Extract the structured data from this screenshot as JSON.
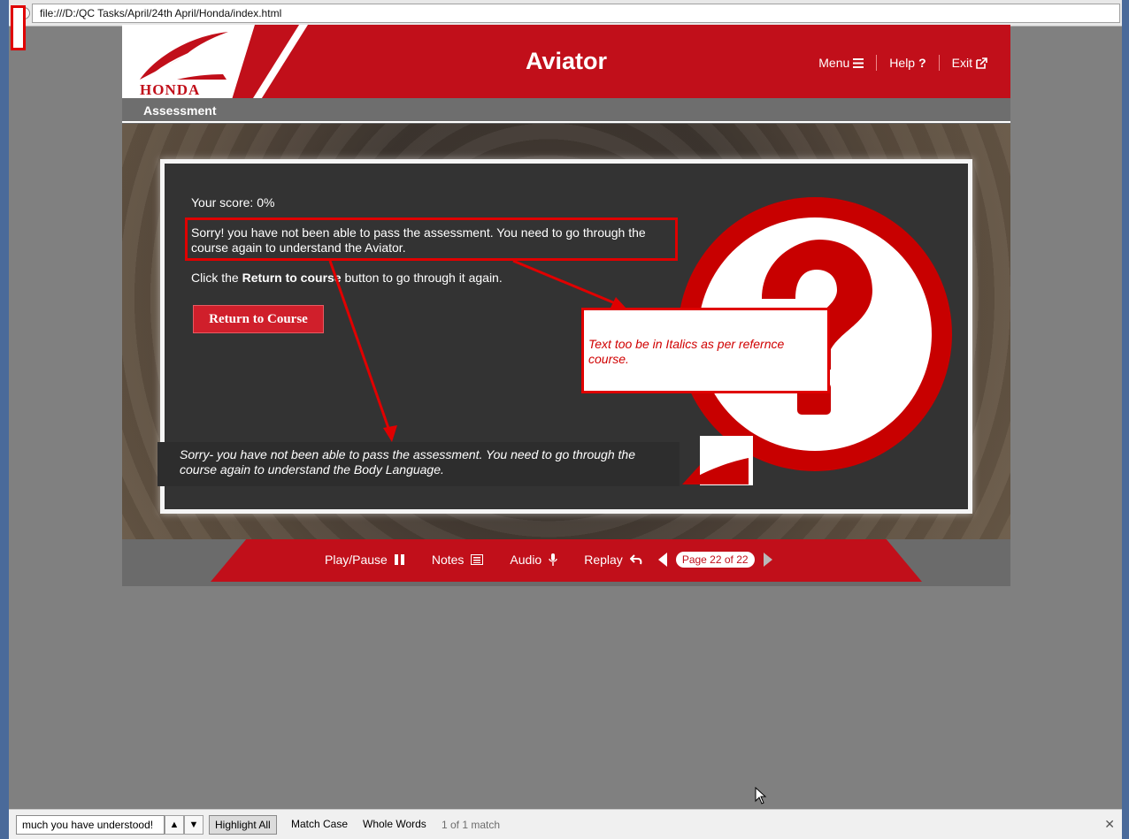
{
  "browser": {
    "address": "file:///D:/QC Tasks/April/24th April/Honda/index.html"
  },
  "course": {
    "logo_text": "HONDA",
    "title": "Aviator",
    "nav": {
      "menu": "Menu",
      "help": "Help",
      "exit": "Exit"
    },
    "section_title": "Assessment",
    "score_text": "Your score: 0%",
    "sorry_text": "Sorry! you have not been able to pass the assessment. You need to go through the course again to understand the Aviator.",
    "click_prefix": "Click the ",
    "click_bold": "Return to course",
    "click_suffix": " button to go through it again.",
    "return_button": "Return to Course",
    "reference_text": "Sorry- you have not been able to pass the assessment. You need to go through the course again to understand the Body Language.",
    "player": {
      "play_pause": "Play/Pause",
      "notes": "Notes",
      "audio": "Audio",
      "replay": "Replay",
      "page_indicator": "Page 22 of 22"
    },
    "colors": {
      "brand_red": "#c10f1a",
      "annotation_red": "#e00000"
    }
  },
  "annotation": {
    "note_text": "Text too be in Italics as per refernce course."
  },
  "findbar": {
    "query": "much you have understood!",
    "highlight_all": "Highlight All",
    "match_case": "Match Case",
    "whole_words": "Whole Words",
    "match_count": "1 of 1 match"
  }
}
